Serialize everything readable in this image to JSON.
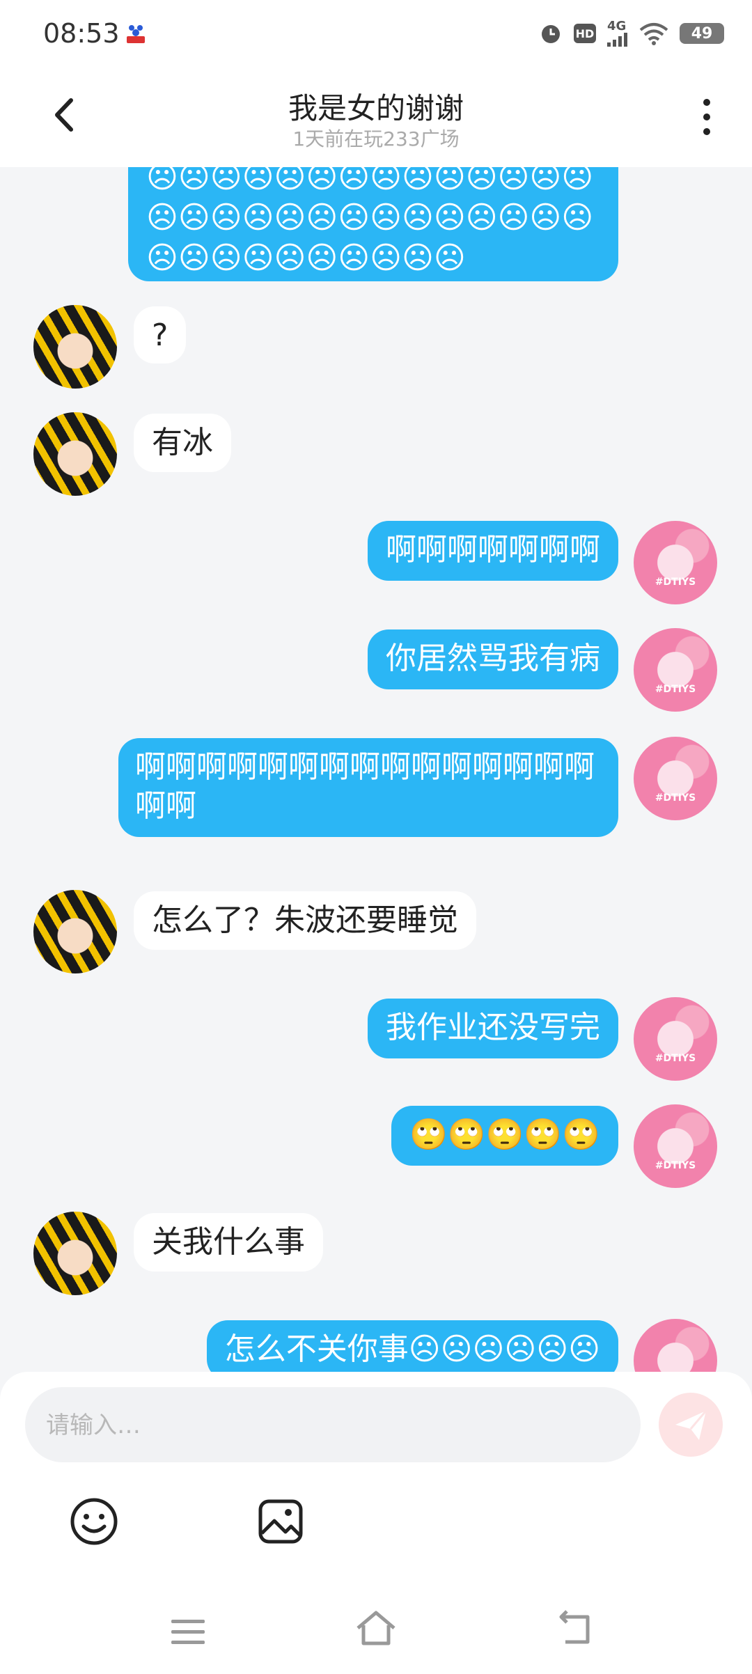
{
  "status_bar": {
    "time": "08:53",
    "battery": "49",
    "network": "4G",
    "hd": "HD"
  },
  "header": {
    "title": "我是女的谢谢",
    "subtitle": "1天前在玩233广场"
  },
  "messages": [
    {
      "from": "me",
      "text": "☹☹☹☹☹☹☹☹☹☹☹☹☹☹☹☹☹☹☹☹☹☹☹☹☹☹☹☹☹☹☹☹☹☹☹☹☹☹"
    },
    {
      "from": "other",
      "text": "?"
    },
    {
      "from": "other",
      "text": "有冰"
    },
    {
      "from": "me",
      "text": "啊啊啊啊啊啊啊"
    },
    {
      "from": "me",
      "text": "你居然骂我有病"
    },
    {
      "from": "me",
      "text": "啊啊啊啊啊啊啊啊啊啊啊啊啊啊啊啊啊"
    },
    {
      "from": "other",
      "text": "怎么了？朱波还要睡觉"
    },
    {
      "from": "me",
      "text": "我作业还没写完"
    },
    {
      "from": "me",
      "text": "🙄🙄🙄🙄🙄"
    },
    {
      "from": "other",
      "text": "关我什么事"
    },
    {
      "from": "me",
      "text": "怎么不关你事☹☹☹☹☹☹"
    }
  ],
  "avatar_tag": "#DTIYS",
  "input": {
    "placeholder": "请输入…",
    "value": ""
  },
  "icons": {
    "back": "chevron-left-icon",
    "more": "more-vertical-icon",
    "send": "send-icon",
    "emoji": "smiley-icon",
    "image": "image-icon",
    "nav_menu": "menu-icon",
    "nav_home": "home-icon",
    "nav_back": "back-icon"
  },
  "colors": {
    "my_bubble": "#2bb6f5",
    "their_bubble": "#ffffff",
    "background": "#f4f5f7",
    "send_button": "#fde3e4"
  }
}
